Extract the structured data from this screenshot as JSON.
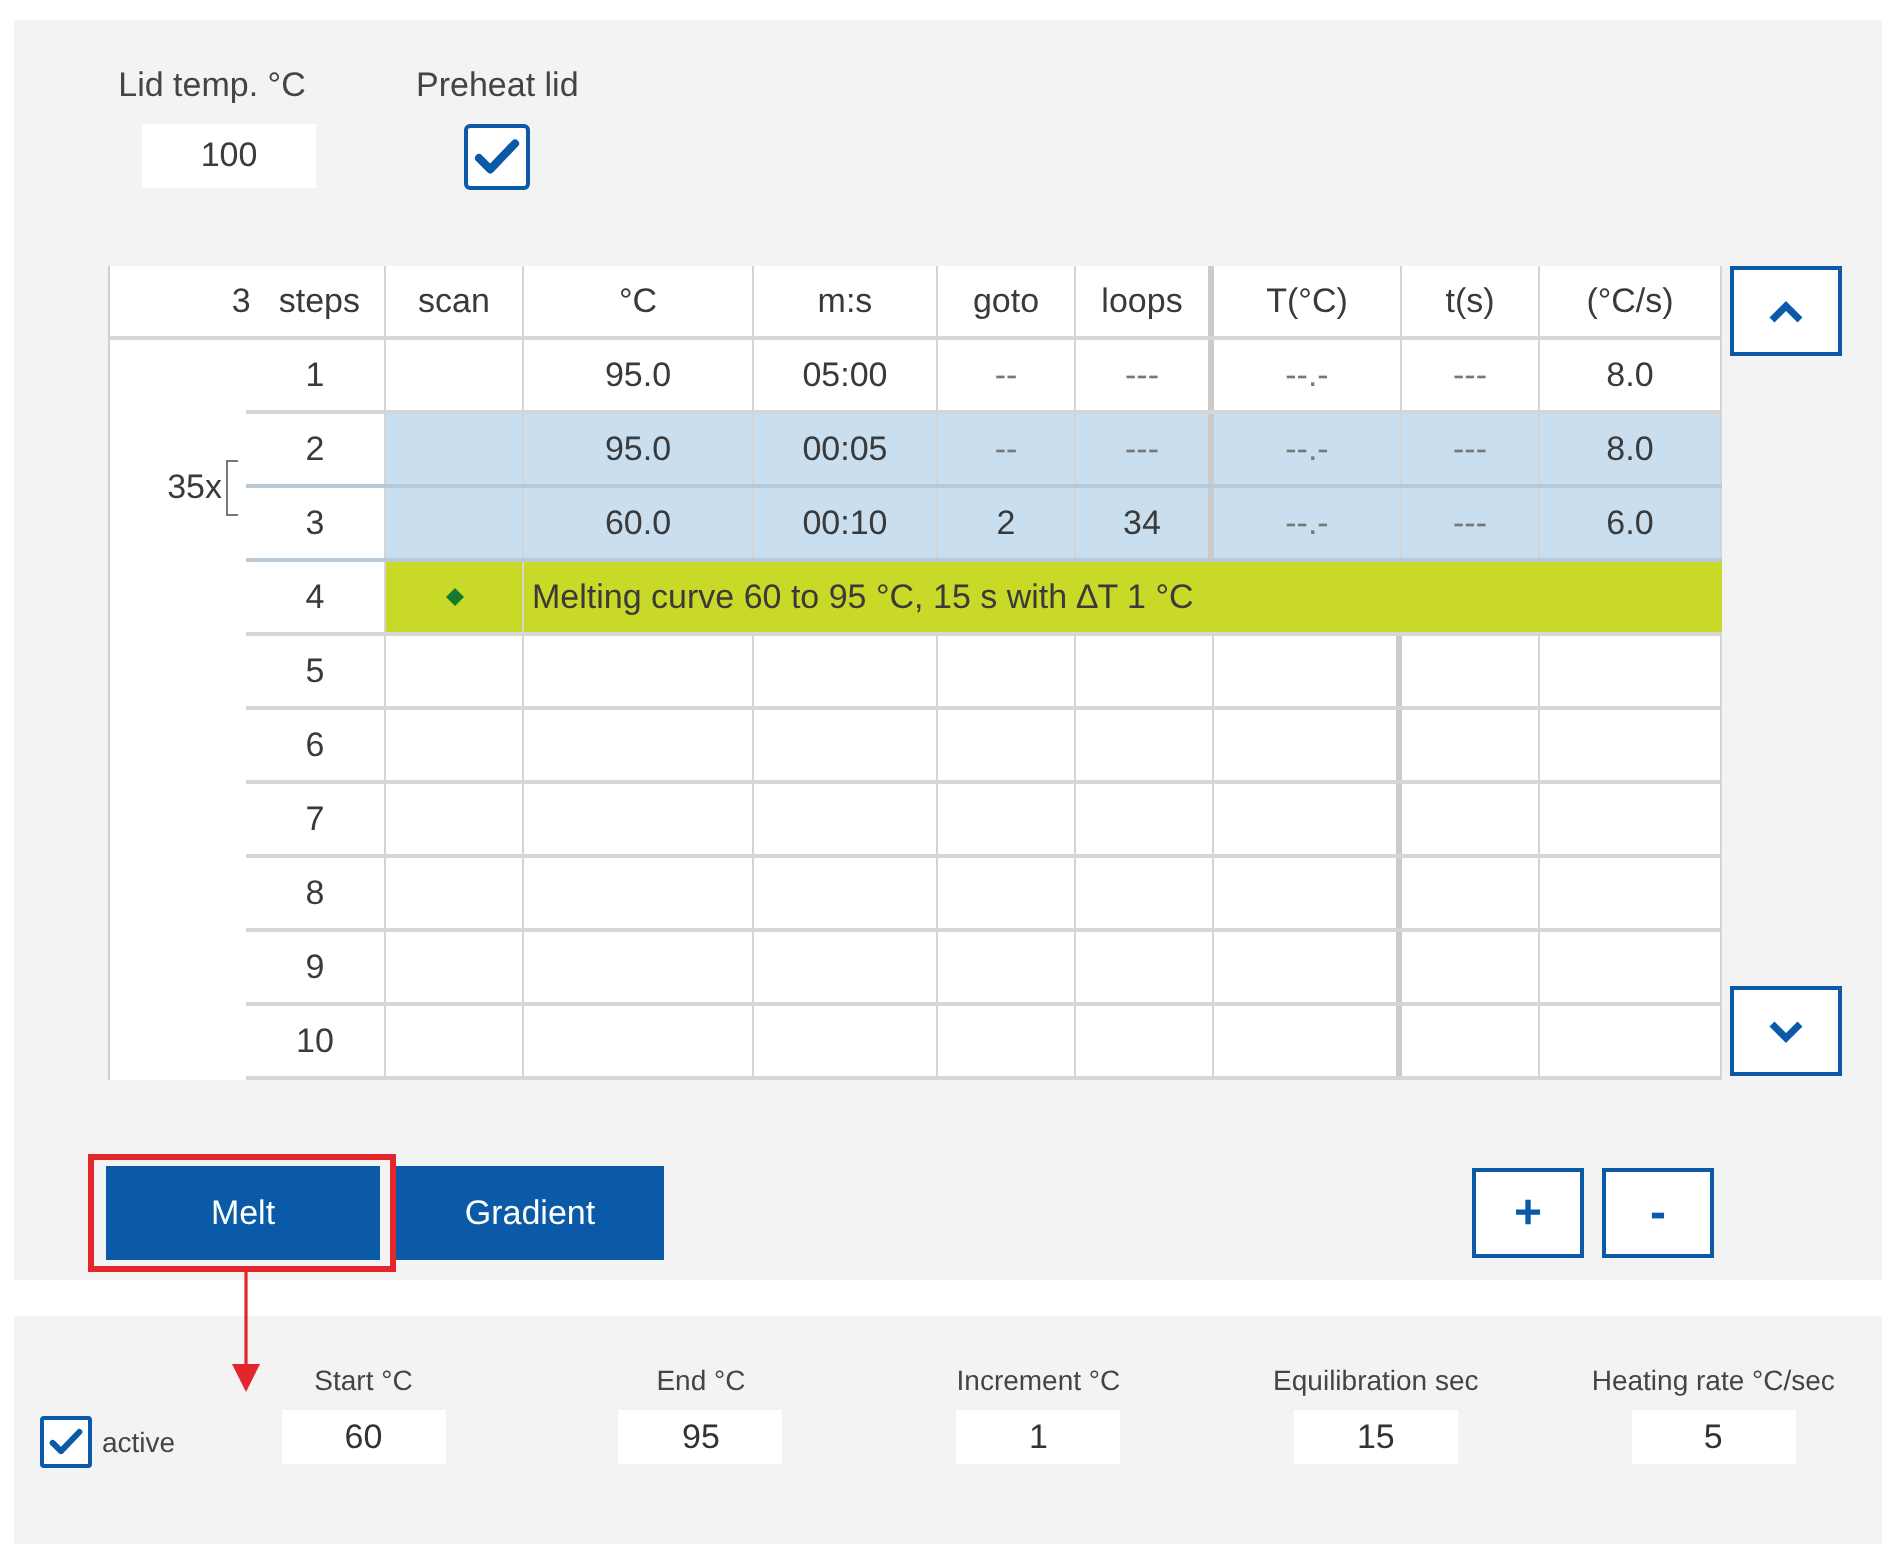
{
  "lid": {
    "temp_label": "Lid temp. °C",
    "temp_value": "100",
    "preheat_label": "Preheat lid",
    "preheat_checked": true
  },
  "table": {
    "step_count": "3",
    "columns": [
      "steps",
      "scan",
      "°C",
      "m:s",
      "goto",
      "loops",
      "T(°C)",
      "t(s)",
      "(°C/s)"
    ],
    "rows": [
      {
        "number": "1",
        "kind": "step",
        "highlighted": false,
        "cells": [
          "",
          "95.0",
          "05:00",
          "--",
          "---",
          "--.-",
          "---",
          "8.0"
        ]
      },
      {
        "kind": "cycle",
        "label": "35x",
        "children": [
          {
            "number": "2",
            "kind": "step",
            "highlighted": true,
            "cells": [
              "",
              "95.0",
              "00:05",
              "--",
              "---",
              "--.-",
              "---",
              "8.0"
            ]
          },
          {
            "number": "3",
            "kind": "step",
            "highlighted": true,
            "cells": [
              "",
              "60.0",
              "00:10",
              "2",
              "34",
              "--.-",
              "---",
              "6.0"
            ]
          }
        ]
      },
      {
        "number": "4",
        "kind": "melt",
        "text": "Melting curve 60 to 95 °C, 15 s with ∆T 1 °C"
      },
      {
        "number": "5",
        "kind": "empty"
      },
      {
        "number": "6",
        "kind": "empty"
      },
      {
        "number": "7",
        "kind": "empty"
      },
      {
        "number": "8",
        "kind": "empty"
      },
      {
        "number": "9",
        "kind": "empty"
      },
      {
        "number": "10",
        "kind": "empty"
      }
    ]
  },
  "mode_buttons": [
    {
      "label": "Melt"
    },
    {
      "label": "Gradient"
    }
  ],
  "annotation": {
    "kind": "frame_and_arrow"
  },
  "step_buttons": [
    "+",
    "-"
  ],
  "melt": {
    "active_label": "active",
    "active_checked": true,
    "fields": [
      {
        "label": "Start °C",
        "value": "60"
      },
      {
        "label": "End °C",
        "value": "95"
      },
      {
        "label": "Increment °C",
        "value": "1"
      },
      {
        "label": "Equilibration sec",
        "value": "15"
      },
      {
        "label": "Heating rate °C/sec",
        "value": "5"
      }
    ]
  }
}
